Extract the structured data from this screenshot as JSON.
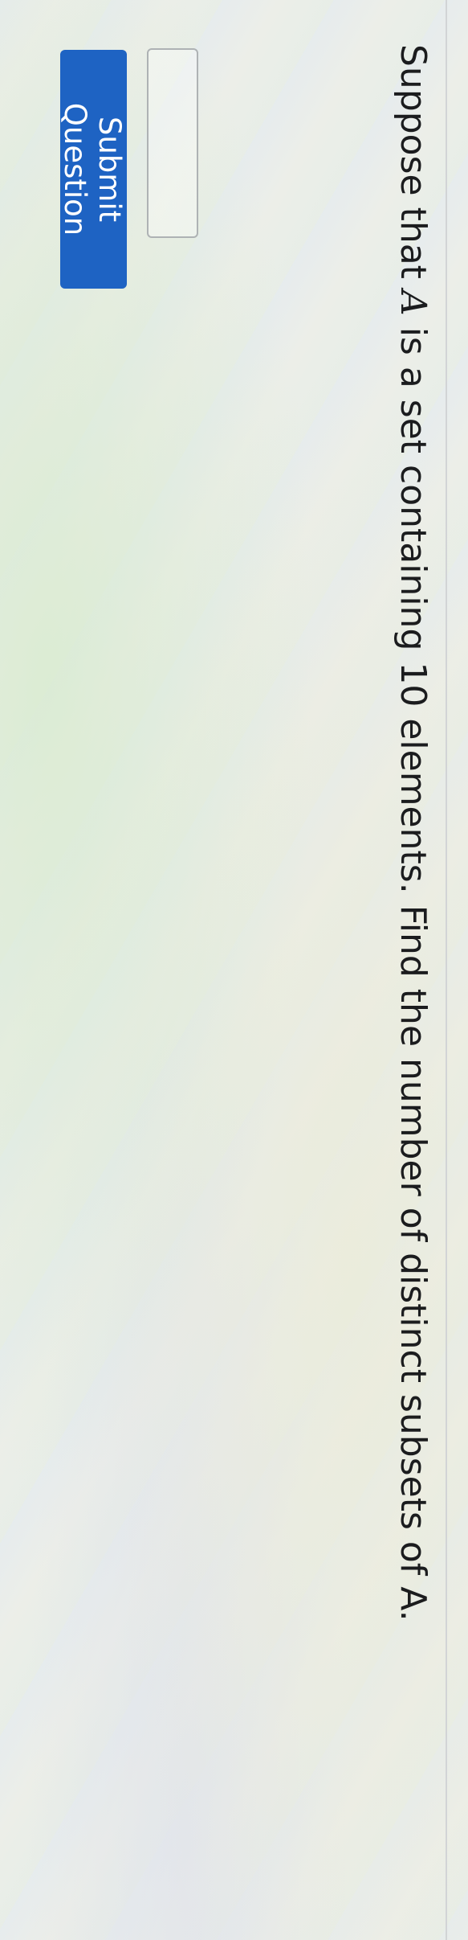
{
  "question": {
    "before_var": "Suppose that ",
    "var": "A",
    "after_var": " is a set containing 10 elements. Find the number of distinct subsets of A."
  },
  "answer": {
    "value": ""
  },
  "submit": {
    "label": "Submit Question"
  },
  "colors": {
    "button_bg": "#1e63c3",
    "button_text": "#ffffff",
    "text": "#1b1c1e"
  }
}
